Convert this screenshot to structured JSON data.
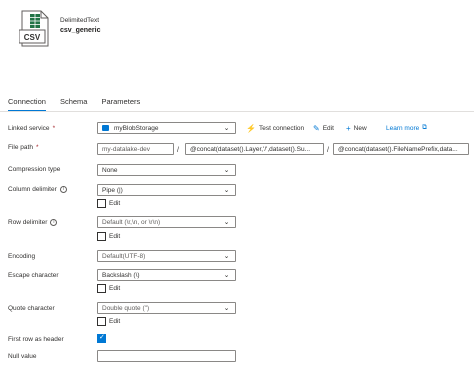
{
  "header": {
    "dataset_type": "DelimitedText",
    "dataset_name": "csv_generic",
    "icon_text": "CSV"
  },
  "tabs": [
    {
      "label": "Connection"
    },
    {
      "label": "Schema"
    },
    {
      "label": "Parameters"
    }
  ],
  "linked_service": {
    "label": "Linked service",
    "required": "*",
    "value": "myBlobStorage",
    "test_connection": "Test connection",
    "edit": "Edit",
    "new": "New",
    "learn_more": "Learn more"
  },
  "file_path": {
    "label": "File path",
    "required": "*",
    "container": "my-datalake-dev",
    "directory": "@concat(dataset().Layer,'/',dataset().Su...",
    "file": "@concat(dataset().FileNamePrefix,data...",
    "separator": "/"
  },
  "compression_type": {
    "label": "Compression type",
    "value": "None"
  },
  "column_delimiter": {
    "label": "Column delimiter",
    "value": "Pipe (|)",
    "edit_label": "Edit"
  },
  "row_delimiter": {
    "label": "Row delimiter",
    "value": "Default (\\r,\\n, or \\r\\n)",
    "edit_label": "Edit"
  },
  "encoding": {
    "label": "Encoding",
    "value": "Default(UTF-8)"
  },
  "escape_character": {
    "label": "Escape character",
    "value": "Backslash (\\)",
    "edit_label": "Edit"
  },
  "quote_character": {
    "label": "Quote character",
    "value": "Double quote (\")",
    "edit_label": "Edit"
  },
  "first_row_header": {
    "label": "First row as header",
    "checked": true
  },
  "null_value": {
    "label": "Null value",
    "value": ""
  },
  "colors": {
    "accent": "#0078d4",
    "required": "#a4262c",
    "border": "#8a8886",
    "csv_green": "#217346"
  }
}
